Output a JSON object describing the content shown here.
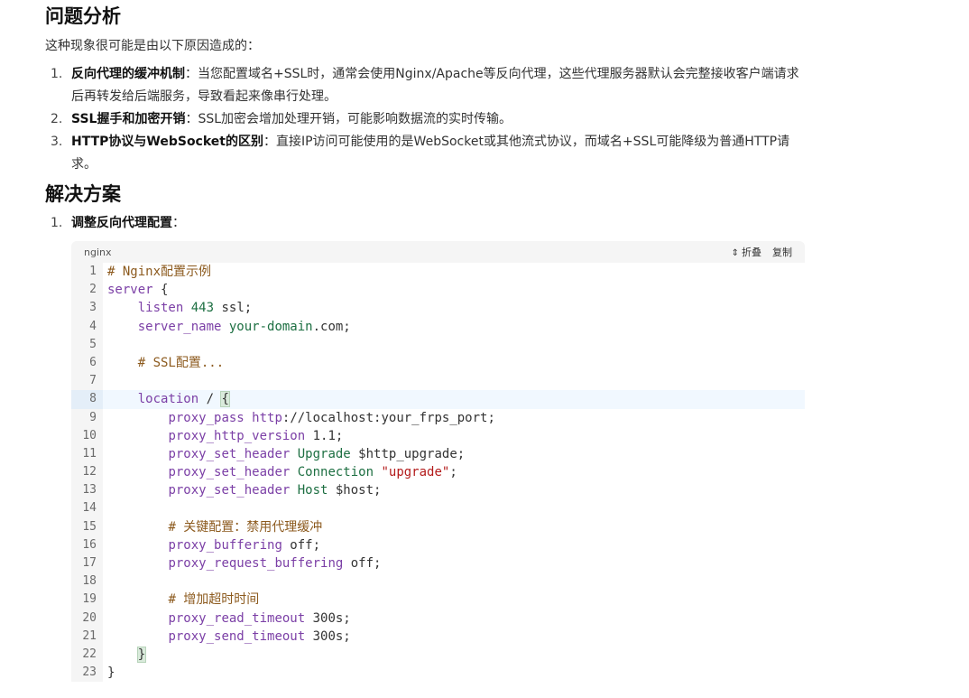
{
  "analysis": {
    "title": "问题分析",
    "intro": "这种现象很可能是由以下原因造成的：",
    "items": [
      {
        "num": "1.",
        "bold": "反向代理的缓冲机制",
        "text": "：当您配置域名+SSL时，通常会使用Nginx/Apache等反向代理，这些代理服务器默认会完整接收客户端请求后再转发给后端服务，导致看起来像串行处理。"
      },
      {
        "num": "2.",
        "bold": "SSL握手和加密开销",
        "text": "：SSL加密会增加处理开销，可能影响数据流的实时传输。"
      },
      {
        "num": "3.",
        "bold": "HTTP协议与WebSocket的区别",
        "text": "：直接IP访问可能使用的是WebSocket或其他流式协议，而域名+SSL可能降级为普通HTTP请求。"
      }
    ]
  },
  "solution": {
    "title": "解决方案",
    "items": [
      {
        "num": "1.",
        "bold": "调整反向代理配置",
        "text": "："
      }
    ]
  },
  "code": {
    "language": "nginx",
    "fold_label": "折叠",
    "copy_label": "复制",
    "fold_icon": "chevron-updown-icon",
    "active_line": 8,
    "lines": [
      {
        "n": "1",
        "text": "# Nginx配置示例"
      },
      {
        "n": "2",
        "text": "server {"
      },
      {
        "n": "3",
        "text": "    listen 443 ssl;"
      },
      {
        "n": "4",
        "text": "    server_name your-domain.com;"
      },
      {
        "n": "5",
        "text": ""
      },
      {
        "n": "6",
        "text": "    # SSL配置..."
      },
      {
        "n": "7",
        "text": ""
      },
      {
        "n": "8",
        "text": "    location / {"
      },
      {
        "n": "9",
        "text": "        proxy_pass http://localhost:your_frps_port;"
      },
      {
        "n": "10",
        "text": "        proxy_http_version 1.1;"
      },
      {
        "n": "11",
        "text": "        proxy_set_header Upgrade $http_upgrade;"
      },
      {
        "n": "12",
        "text": "        proxy_set_header Connection \"upgrade\";"
      },
      {
        "n": "13",
        "text": "        proxy_set_header Host $host;"
      },
      {
        "n": "14",
        "text": ""
      },
      {
        "n": "15",
        "text": "        # 关键配置：禁用代理缓冲"
      },
      {
        "n": "16",
        "text": "        proxy_buffering off;"
      },
      {
        "n": "17",
        "text": "        proxy_request_buffering off;"
      },
      {
        "n": "18",
        "text": ""
      },
      {
        "n": "19",
        "text": "        # 增加超时时间"
      },
      {
        "n": "20",
        "text": "        proxy_read_timeout 300s;"
      },
      {
        "n": "21",
        "text": "        proxy_send_timeout 300s;"
      },
      {
        "n": "22",
        "text": "    }"
      },
      {
        "n": "23",
        "text": "}"
      }
    ]
  }
}
